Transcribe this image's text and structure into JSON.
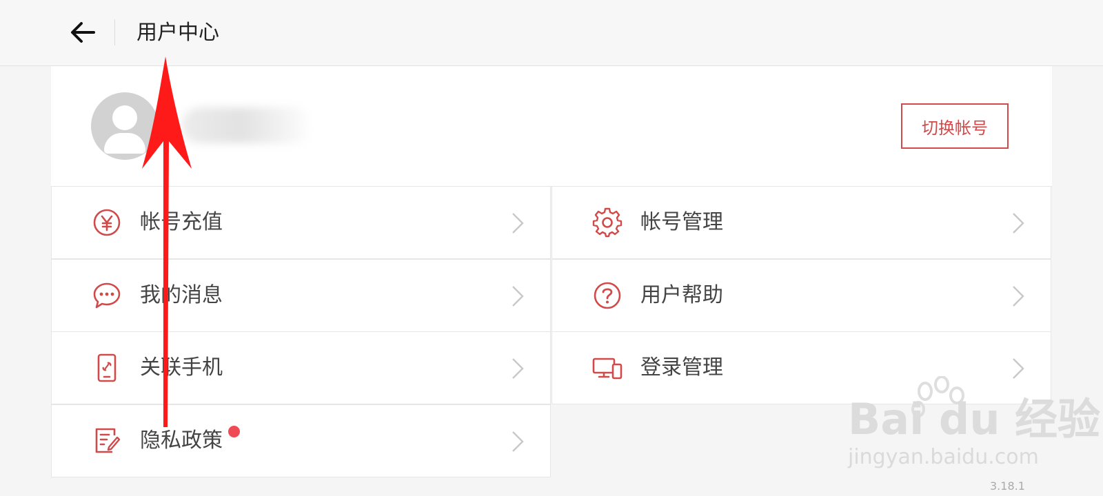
{
  "header": {
    "title": "用户中心",
    "back_icon": "arrow-left-icon"
  },
  "profile": {
    "avatar_icon": "user-avatar-icon",
    "switch_account_label": "切换帐号"
  },
  "menu": {
    "left": [
      {
        "label": "帐号充值",
        "icon": "yen-icon"
      },
      {
        "label": "我的消息",
        "icon": "chat-bubble-icon"
      },
      {
        "label": "关联手机",
        "icon": "phone-link-icon"
      },
      {
        "label": "隐私政策",
        "icon": "document-edit-icon",
        "badge": "red-dot"
      }
    ],
    "right": [
      {
        "label": "帐号管理",
        "icon": "gear-icon"
      },
      {
        "label": "用户帮助",
        "icon": "question-icon"
      },
      {
        "label": "登录管理",
        "icon": "devices-icon"
      }
    ]
  },
  "watermark": {
    "brand": "Bai du 经验",
    "url": "jingyan.baidu.com"
  },
  "footer": {
    "version": "3.18.1"
  },
  "colors": {
    "accent": "#d04a4a",
    "badge": "#ef4b55",
    "annotation_arrow": "#ff1a1a"
  }
}
